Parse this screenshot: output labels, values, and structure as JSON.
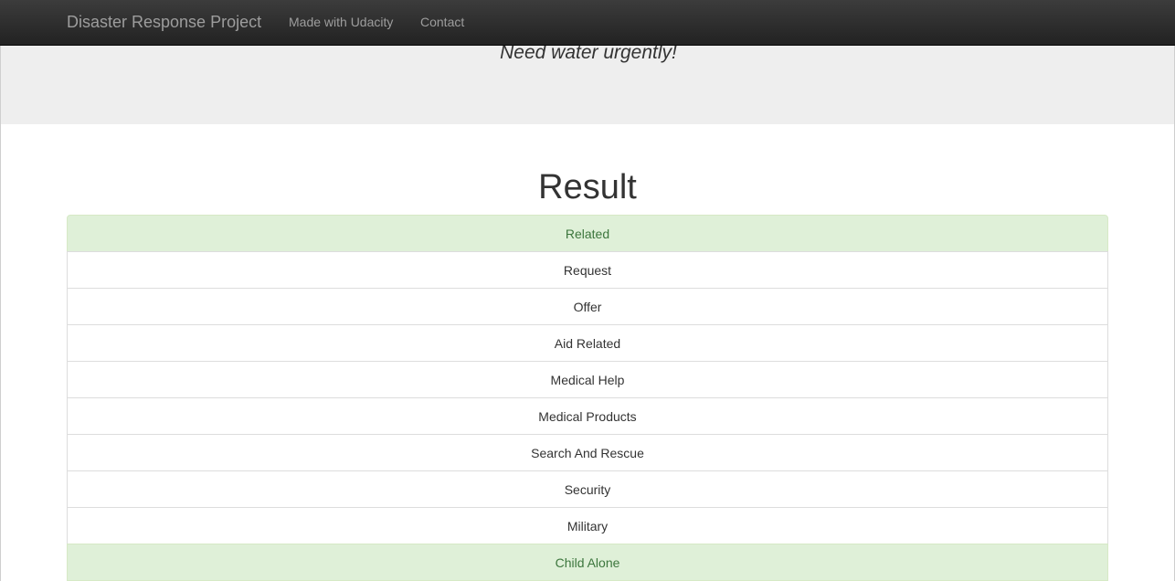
{
  "navbar": {
    "brand": "Disaster Response Project",
    "links": [
      {
        "label": "Made with Udacity"
      },
      {
        "label": "Contact"
      }
    ]
  },
  "jumbotron": {
    "query": "Need water urgently!"
  },
  "result": {
    "heading": "Result",
    "categories": [
      {
        "label": "Related",
        "positive": true
      },
      {
        "label": "Request",
        "positive": false
      },
      {
        "label": "Offer",
        "positive": false
      },
      {
        "label": "Aid Related",
        "positive": false
      },
      {
        "label": "Medical Help",
        "positive": false
      },
      {
        "label": "Medical Products",
        "positive": false
      },
      {
        "label": "Search And Rescue",
        "positive": false
      },
      {
        "label": "Security",
        "positive": false
      },
      {
        "label": "Military",
        "positive": false
      },
      {
        "label": "Child Alone",
        "positive": true
      }
    ]
  },
  "colors": {
    "navbar_bg": "#222222",
    "navbar_text": "#9d9d9d",
    "jumbotron_bg": "#eeeeee",
    "success_bg": "#dff0d8",
    "success_text": "#3c763d",
    "border": "#dddddd"
  }
}
